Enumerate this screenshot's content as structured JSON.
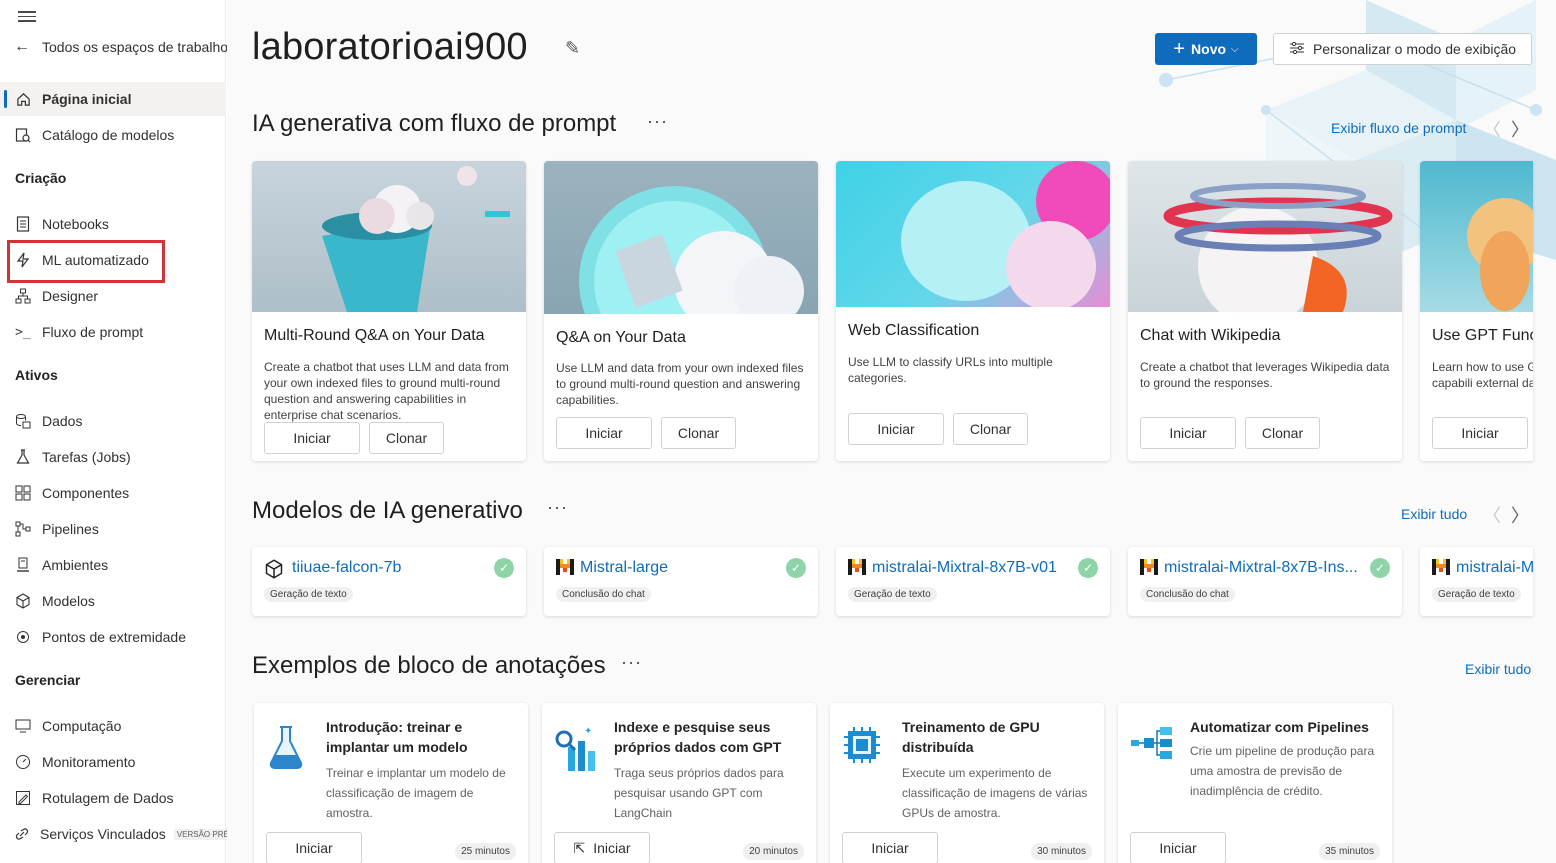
{
  "sidebar": {
    "back_label": "Todos os espaços de trabalho",
    "items_top": [
      {
        "label": "Página inicial",
        "icon": "home-icon",
        "active": true
      },
      {
        "label": "Catálogo de modelos",
        "icon": "catalog-icon"
      }
    ],
    "sections": [
      {
        "title": "Criação",
        "items": [
          {
            "label": "Notebooks",
            "icon": "notebook-icon"
          },
          {
            "label": "ML automatizado",
            "icon": "automl-icon"
          },
          {
            "label": "Designer",
            "icon": "designer-icon"
          },
          {
            "label": "Fluxo de prompt",
            "icon": "prompt-flow-icon"
          }
        ]
      },
      {
        "title": "Ativos",
        "items": [
          {
            "label": "Dados",
            "icon": "data-icon"
          },
          {
            "label": "Tarefas (Jobs)",
            "icon": "jobs-icon"
          },
          {
            "label": "Componentes",
            "icon": "components-icon"
          },
          {
            "label": "Pipelines",
            "icon": "pipelines-icon"
          },
          {
            "label": "Ambientes",
            "icon": "environments-icon"
          },
          {
            "label": "Modelos",
            "icon": "models-icon"
          },
          {
            "label": "Pontos de extremidade",
            "icon": "endpoints-icon"
          }
        ]
      },
      {
        "title": "Gerenciar",
        "items": [
          {
            "label": "Computação",
            "icon": "compute-icon"
          },
          {
            "label": "Monitoramento",
            "icon": "monitoring-icon"
          },
          {
            "label": "Rotulagem de Dados",
            "icon": "labeling-icon"
          },
          {
            "label": "Serviços Vinculados",
            "icon": "linked-services-icon",
            "badge": "VERSÃO PRÉVIA"
          }
        ]
      }
    ]
  },
  "header": {
    "workspace_name": "laboratorioai900",
    "new_button": "Novo",
    "customize_button": "Personalizar o modo de exibição"
  },
  "prompt_flow": {
    "title": "IA generativa com fluxo de prompt",
    "more": "···",
    "see_link": "Exibir fluxo de prompt",
    "cards": [
      {
        "title": "Multi-Round Q&A on Your Data",
        "description": "Create a chatbot that uses LLM and data from your own indexed files to ground multi-round question and answering capabilities in enterprise chat scenarios.",
        "start": "Iniciar",
        "clone": "Clonar"
      },
      {
        "title": "Q&A on Your Data",
        "description": "Use LLM and data from your own indexed files to ground multi-round question and answering capabilities.",
        "start": "Iniciar",
        "clone": "Clonar"
      },
      {
        "title": "Web Classification",
        "description": "Use LLM to classify URLs into multiple categories.",
        "start": "Iniciar",
        "clone": "Clonar"
      },
      {
        "title": "Chat with Wikipedia",
        "description": "Create a chatbot that leverages Wikipedia data to ground the responses.",
        "start": "Iniciar",
        "clone": "Clonar"
      },
      {
        "title": "Use GPT Funct",
        "description": "Learn how to use G extend the capabili external data sourc",
        "start": "Iniciar"
      }
    ]
  },
  "models": {
    "title": "Modelos de IA generativo",
    "more": "···",
    "see_link": "Exibir tudo",
    "cards": [
      {
        "name": "tiiuae-falcon-7b",
        "tag": "Geração de texto",
        "icon": "cube-icon"
      },
      {
        "name": "Mistral-large",
        "tag": "Conclusão do chat",
        "icon": "mistral-logo-icon"
      },
      {
        "name": "mistralai-Mixtral-8x7B-v01",
        "tag": "Geração de texto",
        "icon": "mistral-logo-icon"
      },
      {
        "name": "mistralai-Mixtral-8x7B-Ins...",
        "tag": "Conclusão do chat",
        "icon": "mistral-logo-icon"
      },
      {
        "name": "mistralai-M",
        "tag": "Geração de texto",
        "icon": "mistral-logo-icon"
      }
    ]
  },
  "notebooks": {
    "title": "Exemplos de bloco de anotações",
    "more": "···",
    "see_link": "Exibir tudo",
    "cards": [
      {
        "title": "Introdução: treinar e implantar um modelo",
        "description": "Treinar e implantar um modelo de classificação de imagem de amostra.",
        "start": "Iniciar",
        "time": "25 minutos",
        "icon": "flask-icon"
      },
      {
        "title": "Indexe e pesquise seus próprios dados com GPT",
        "description": "Traga seus próprios dados para pesquisar usando GPT com LangChain",
        "start": "Iniciar",
        "time": "20 minutos",
        "icon": "search-chart-icon"
      },
      {
        "title": "Treinamento de GPU distribuída",
        "description": "Execute um experimento de classificação de imagens de várias GPUs de amostra.",
        "start": "Iniciar",
        "time": "30 minutos",
        "icon": "gpu-chip-icon"
      },
      {
        "title": "Automatizar com Pipelines",
        "description": "Crie um pipeline de produção para uma amostra de previsão de inadimplência de crédito.",
        "start": "Iniciar",
        "time": "35 minutos",
        "icon": "pipeline-icon"
      }
    ]
  }
}
